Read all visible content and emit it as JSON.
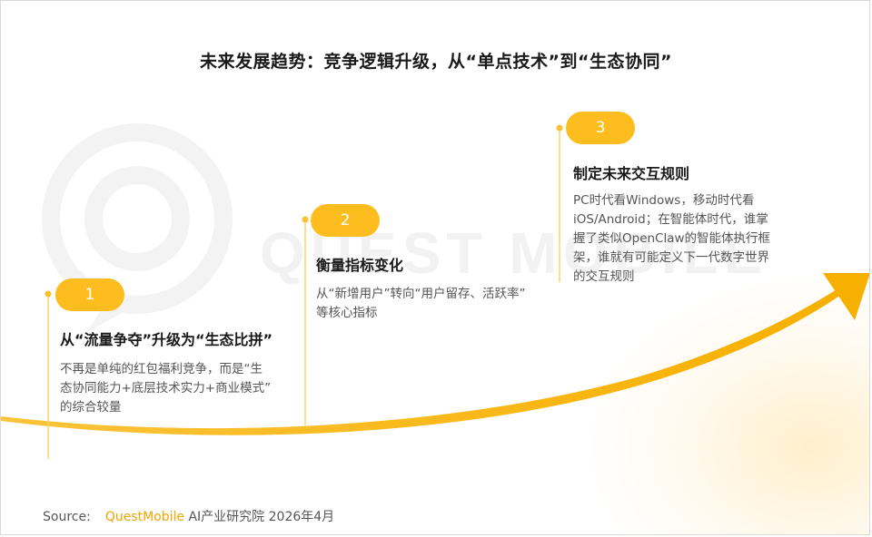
{
  "title": "未来发展趋势：竞争逻辑升级，从“单点技术”到“生态协同”",
  "colors": {
    "accent": "#fdbd1f",
    "arrow": "#f7b500",
    "watermark": "#f2f2f2"
  },
  "watermark": {
    "text": "QUEST MOBILE",
    "icon": "questmobile-logo-icon"
  },
  "steps": [
    {
      "number": "1",
      "title": "从“流量争夺”升级为“生态比拼”",
      "desc": [
        "不再是单纯的红包福利竞争，而是“生",
        "态协同能力+底层技术实力+商业模式”",
        "的综合较量"
      ]
    },
    {
      "number": "2",
      "title": "衡量指标变化",
      "desc": [
        "从“新增用户”转向“用户留存、活跃率”",
        "等核心指标"
      ]
    },
    {
      "number": "3",
      "title": "制定未来交互规则",
      "desc": [
        "PC时代看Windows，移动时代看",
        "iOS/Android；在智能体时代，谁掌",
        "握了类似OpenClaw的智能体执行框",
        "架，谁就有可能定义下一代数字世界",
        "的交互规则"
      ]
    }
  ],
  "source": {
    "label": "Source:",
    "brand": "QuestMobile",
    "rest": " AI产业研究院 2026年4月"
  }
}
